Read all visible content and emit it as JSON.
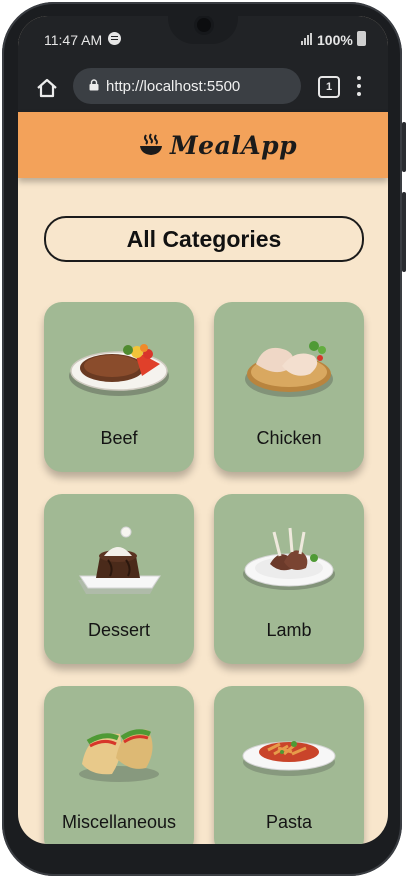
{
  "status_bar": {
    "time": "11:47 AM",
    "battery": "100%"
  },
  "browser": {
    "url": "http://localhost:5500",
    "tab_count": "1"
  },
  "app": {
    "brand": "MealApp",
    "title": "All Categories"
  },
  "categories": [
    {
      "name": "Beef",
      "icon": "steak-plate-icon"
    },
    {
      "name": "Chicken",
      "icon": "chicken-plate-icon"
    },
    {
      "name": "Dessert",
      "icon": "cake-plate-icon"
    },
    {
      "name": "Lamb",
      "icon": "lamb-plate-icon"
    },
    {
      "name": "Miscellaneous",
      "icon": "taco-icon"
    },
    {
      "name": "Pasta",
      "icon": "pasta-plate-icon"
    }
  ],
  "colors": {
    "header": "#f3a25a",
    "background": "#f8e6cc",
    "card": "#a1b994",
    "browser_chrome": "#212326"
  }
}
